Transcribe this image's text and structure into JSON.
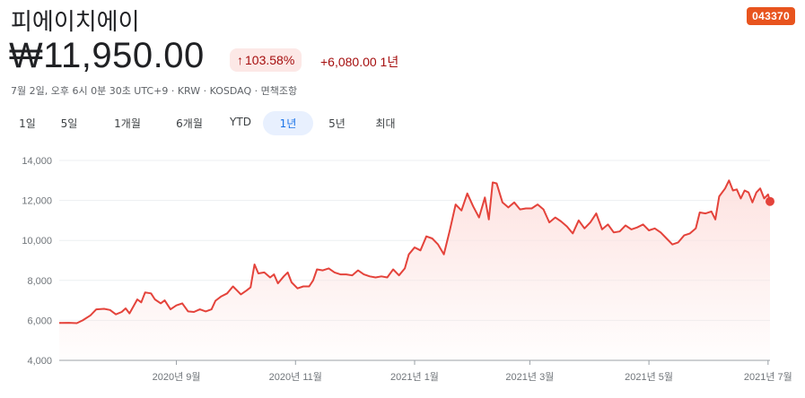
{
  "stock": {
    "name": "피에이치에이",
    "ticker": "043370",
    "price": "₩11,950.00",
    "change_pct": "103.58%",
    "change_abs": "+6,080.00 1년",
    "meta": "7월 2일, 오후 6시 0분 30초 UTC+9 · KRW · KOSDAQ · 면책조항"
  },
  "ranges": [
    {
      "label": "1일"
    },
    {
      "label": "5일"
    },
    {
      "label": "1개월"
    },
    {
      "label": "6개월"
    },
    {
      "label": "YTD"
    },
    {
      "label": "1년",
      "active": true
    },
    {
      "label": "5년"
    },
    {
      "label": "최대"
    }
  ],
  "colors": {
    "line": "#e4433b",
    "fill": "#fde3e1",
    "ticker_bg": "#e8541e",
    "active_range": "#1a73e8"
  },
  "chart_data": {
    "type": "area",
    "ylim": [
      4000,
      14000
    ],
    "yticks": [
      4000,
      6000,
      8000,
      10000,
      12000,
      14000
    ],
    "ytick_labels": [
      "4,000",
      "6,000",
      "8,000",
      "10,000",
      "12,000",
      "14,000"
    ],
    "xlim": [
      "2020-07-03",
      "2021-07-02"
    ],
    "xticks": [
      {
        "date": "2020-09-01",
        "label": "2020년 9월"
      },
      {
        "date": "2020-11-01",
        "label": "2020년 11월"
      },
      {
        "date": "2021-01-01",
        "label": "2021년 1월"
      },
      {
        "date": "2021-03-01",
        "label": "2021년 3월"
      },
      {
        "date": "2021-05-01",
        "label": "2021년 5월"
      },
      {
        "date": "2021-07-01",
        "label": "2021년 7월"
      }
    ],
    "grid": true,
    "series": [
      {
        "points": [
          [
            "2020-07-03",
            5870
          ],
          [
            "2020-07-08",
            5880
          ],
          [
            "2020-07-12",
            5860
          ],
          [
            "2020-07-15",
            6000
          ],
          [
            "2020-07-19",
            6250
          ],
          [
            "2020-07-22",
            6550
          ],
          [
            "2020-07-26",
            6580
          ],
          [
            "2020-07-29",
            6520
          ],
          [
            "2020-08-01",
            6300
          ],
          [
            "2020-08-04",
            6420
          ],
          [
            "2020-08-06",
            6600
          ],
          [
            "2020-08-08",
            6350
          ],
          [
            "2020-08-10",
            6700
          ],
          [
            "2020-08-12",
            7050
          ],
          [
            "2020-08-14",
            6900
          ],
          [
            "2020-08-16",
            7400
          ],
          [
            "2020-08-19",
            7350
          ],
          [
            "2020-08-21",
            7050
          ],
          [
            "2020-08-24",
            6850
          ],
          [
            "2020-08-26",
            7000
          ],
          [
            "2020-08-29",
            6550
          ],
          [
            "2020-09-01",
            6750
          ],
          [
            "2020-09-04",
            6850
          ],
          [
            "2020-09-07",
            6450
          ],
          [
            "2020-09-10",
            6420
          ],
          [
            "2020-09-13",
            6550
          ],
          [
            "2020-09-16",
            6450
          ],
          [
            "2020-09-19",
            6550
          ],
          [
            "2020-09-21",
            6980
          ],
          [
            "2020-09-24",
            7200
          ],
          [
            "2020-09-27",
            7350
          ],
          [
            "2020-09-30",
            7700
          ],
          [
            "2020-10-02",
            7500
          ],
          [
            "2020-10-04",
            7300
          ],
          [
            "2020-10-07",
            7500
          ],
          [
            "2020-10-09",
            7650
          ],
          [
            "2020-10-11",
            8800
          ],
          [
            "2020-10-13",
            8350
          ],
          [
            "2020-10-16",
            8400
          ],
          [
            "2020-10-19",
            8150
          ],
          [
            "2020-10-21",
            8300
          ],
          [
            "2020-10-23",
            7850
          ],
          [
            "2020-10-26",
            8200
          ],
          [
            "2020-10-28",
            8400
          ],
          [
            "2020-10-30",
            7900
          ],
          [
            "2020-11-02",
            7600
          ],
          [
            "2020-11-05",
            7700
          ],
          [
            "2020-11-08",
            7700
          ],
          [
            "2020-11-10",
            8000
          ],
          [
            "2020-11-12",
            8550
          ],
          [
            "2020-11-15",
            8500
          ],
          [
            "2020-11-18",
            8600
          ],
          [
            "2020-11-21",
            8400
          ],
          [
            "2020-11-24",
            8300
          ],
          [
            "2020-11-27",
            8300
          ],
          [
            "2020-11-30",
            8250
          ],
          [
            "2020-12-03",
            8500
          ],
          [
            "2020-12-06",
            8300
          ],
          [
            "2020-12-09",
            8200
          ],
          [
            "2020-12-12",
            8150
          ],
          [
            "2020-12-15",
            8200
          ],
          [
            "2020-12-18",
            8150
          ],
          [
            "2020-12-21",
            8550
          ],
          [
            "2020-12-24",
            8250
          ],
          [
            "2020-12-27",
            8600
          ],
          [
            "2020-12-29",
            9300
          ],
          [
            "2021-01-01",
            9650
          ],
          [
            "2021-01-04",
            9500
          ],
          [
            "2021-01-07",
            10200
          ],
          [
            "2021-01-10",
            10100
          ],
          [
            "2021-01-13",
            9800
          ],
          [
            "2021-01-16",
            9300
          ],
          [
            "2021-01-19",
            10500
          ],
          [
            "2021-01-22",
            11800
          ],
          [
            "2021-01-25",
            11500
          ],
          [
            "2021-01-28",
            12350
          ],
          [
            "2021-01-31",
            11700
          ],
          [
            "2021-02-03",
            11150
          ],
          [
            "2021-02-06",
            12150
          ],
          [
            "2021-02-08",
            11050
          ],
          [
            "2021-02-10",
            12900
          ],
          [
            "2021-02-12",
            12850
          ],
          [
            "2021-02-15",
            11900
          ],
          [
            "2021-02-18",
            11650
          ],
          [
            "2021-02-21",
            11900
          ],
          [
            "2021-02-24",
            11550
          ],
          [
            "2021-02-27",
            11600
          ],
          [
            "2021-03-02",
            11600
          ],
          [
            "2021-03-05",
            11800
          ],
          [
            "2021-03-08",
            11550
          ],
          [
            "2021-03-11",
            10900
          ],
          [
            "2021-03-14",
            11150
          ],
          [
            "2021-03-17",
            10950
          ],
          [
            "2021-03-20",
            10700
          ],
          [
            "2021-03-23",
            10350
          ],
          [
            "2021-03-26",
            11000
          ],
          [
            "2021-03-29",
            10600
          ],
          [
            "2021-04-01",
            10900
          ],
          [
            "2021-04-04",
            11350
          ],
          [
            "2021-04-07",
            10550
          ],
          [
            "2021-04-10",
            10800
          ],
          [
            "2021-04-13",
            10400
          ],
          [
            "2021-04-16",
            10450
          ],
          [
            "2021-04-19",
            10750
          ],
          [
            "2021-04-22",
            10550
          ],
          [
            "2021-04-25",
            10650
          ],
          [
            "2021-04-28",
            10800
          ],
          [
            "2021-05-01",
            10500
          ],
          [
            "2021-05-04",
            10600
          ],
          [
            "2021-05-07",
            10400
          ],
          [
            "2021-05-10",
            10100
          ],
          [
            "2021-05-13",
            9800
          ],
          [
            "2021-05-16",
            9900
          ],
          [
            "2021-05-19",
            10250
          ],
          [
            "2021-05-22",
            10350
          ],
          [
            "2021-05-25",
            10600
          ],
          [
            "2021-05-27",
            11400
          ],
          [
            "2021-05-30",
            11350
          ],
          [
            "2021-06-02",
            11450
          ],
          [
            "2021-06-04",
            11050
          ],
          [
            "2021-06-06",
            12200
          ],
          [
            "2021-06-09",
            12600
          ],
          [
            "2021-06-11",
            13000
          ],
          [
            "2021-06-13",
            12500
          ],
          [
            "2021-06-15",
            12550
          ],
          [
            "2021-06-17",
            12100
          ],
          [
            "2021-06-19",
            12500
          ],
          [
            "2021-06-21",
            12400
          ],
          [
            "2021-06-23",
            11900
          ],
          [
            "2021-06-25",
            12400
          ],
          [
            "2021-06-27",
            12600
          ],
          [
            "2021-06-29",
            12100
          ],
          [
            "2021-07-01",
            12300
          ],
          [
            "2021-07-02",
            11950
          ]
        ]
      }
    ]
  }
}
